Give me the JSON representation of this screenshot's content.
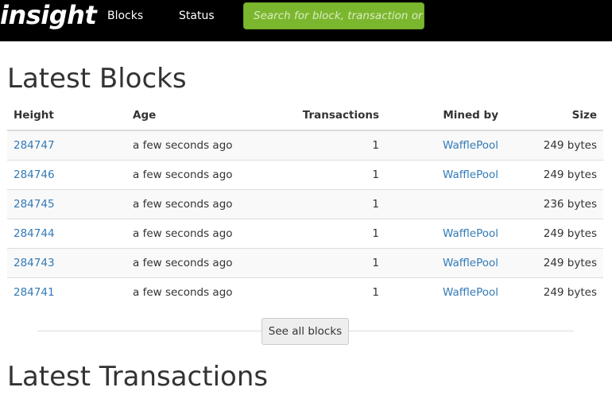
{
  "nav": {
    "brand": "insight",
    "links": [
      "Blocks",
      "Status"
    ],
    "search_placeholder": "Search for block, transaction or address"
  },
  "main": {
    "title": "Latest Blocks",
    "table": {
      "headers": [
        "Height",
        "Age",
        "Transactions",
        "Mined by",
        "Size"
      ],
      "rows": [
        {
          "height": "284747",
          "age": "a few seconds ago",
          "transactions": "1",
          "mined_by": "WafflePool",
          "size": "249 bytes"
        },
        {
          "height": "284746",
          "age": "a few seconds ago",
          "transactions": "1",
          "mined_by": "WafflePool",
          "size": "249 bytes"
        },
        {
          "height": "284745",
          "age": "a few seconds ago",
          "transactions": "1",
          "mined_by": "",
          "size": "236 bytes"
        },
        {
          "height": "284744",
          "age": "a few seconds ago",
          "transactions": "1",
          "mined_by": "WafflePool",
          "size": "249 bytes"
        },
        {
          "height": "284743",
          "age": "a few seconds ago",
          "transactions": "1",
          "mined_by": "WafflePool",
          "size": "249 bytes"
        },
        {
          "height": "284741",
          "age": "a few seconds ago",
          "transactions": "1",
          "mined_by": "WafflePool",
          "size": "249 bytes"
        }
      ]
    },
    "see_all_label": "See all blocks",
    "next_section_title": "Latest Transactions"
  },
  "colors": {
    "navbar_bg": "#000000",
    "search_bg": "#7bb72e",
    "link": "#337ab7"
  }
}
